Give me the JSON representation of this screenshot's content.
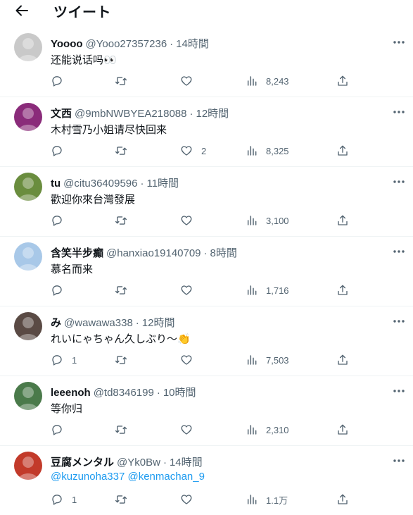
{
  "header": {
    "back_icon": "arrow-left-icon",
    "title": "ツイート"
  },
  "tweets": [
    {
      "name": "Yoooo",
      "handle": "@Yooo27357236",
      "time": "14時間",
      "text": "还能说话吗👀",
      "replies": "",
      "likes": "",
      "views": "8,243",
      "avatar_color": "#c9c9c9"
    },
    {
      "name": "文西",
      "handle": "@9mbNWBYEA218088",
      "time": "12時間",
      "text": "木村雪乃小姐请尽快回来",
      "replies": "",
      "likes": "2",
      "views": "8,325",
      "avatar_color": "#8a2b7a"
    },
    {
      "name": "tu",
      "handle": "@citu36409596",
      "time": "11時間",
      "text": "歡迎你來台灣發展",
      "replies": "",
      "likes": "",
      "views": "3,100",
      "avatar_color": "#6a8d3e"
    },
    {
      "name": "含笑半步癫",
      "handle": "@hanxiao19140709",
      "time": "8時間",
      "text": "慕名而来",
      "replies": "",
      "likes": "",
      "views": "1,716",
      "avatar_color": "#a8c8e8"
    },
    {
      "name": "み",
      "handle": "@wawawa338",
      "time": "12時間",
      "text": "れいにゃちゃん久しぶり〜👏",
      "replies": "1",
      "likes": "",
      "views": "7,503",
      "avatar_color": "#5a4a44"
    },
    {
      "name": "leeenoh",
      "handle": "@td8346199",
      "time": "10時間",
      "text": "等你归",
      "replies": "",
      "likes": "",
      "views": "2,310",
      "avatar_color": "#4a7a4a"
    },
    {
      "name": "豆腐メンタル",
      "handle": "@Yk0Bw",
      "time": "14時間",
      "text": "",
      "mentions": [
        "@kuzunoha337",
        "@kenmachan_9"
      ],
      "replies": "1",
      "likes": "",
      "views": "1.1万",
      "avatar_color": "#c23a2a"
    }
  ],
  "colors": {
    "text": "#0f1419",
    "muted": "#536471",
    "link": "#1d9bf0",
    "divider": "#eff3f4"
  }
}
